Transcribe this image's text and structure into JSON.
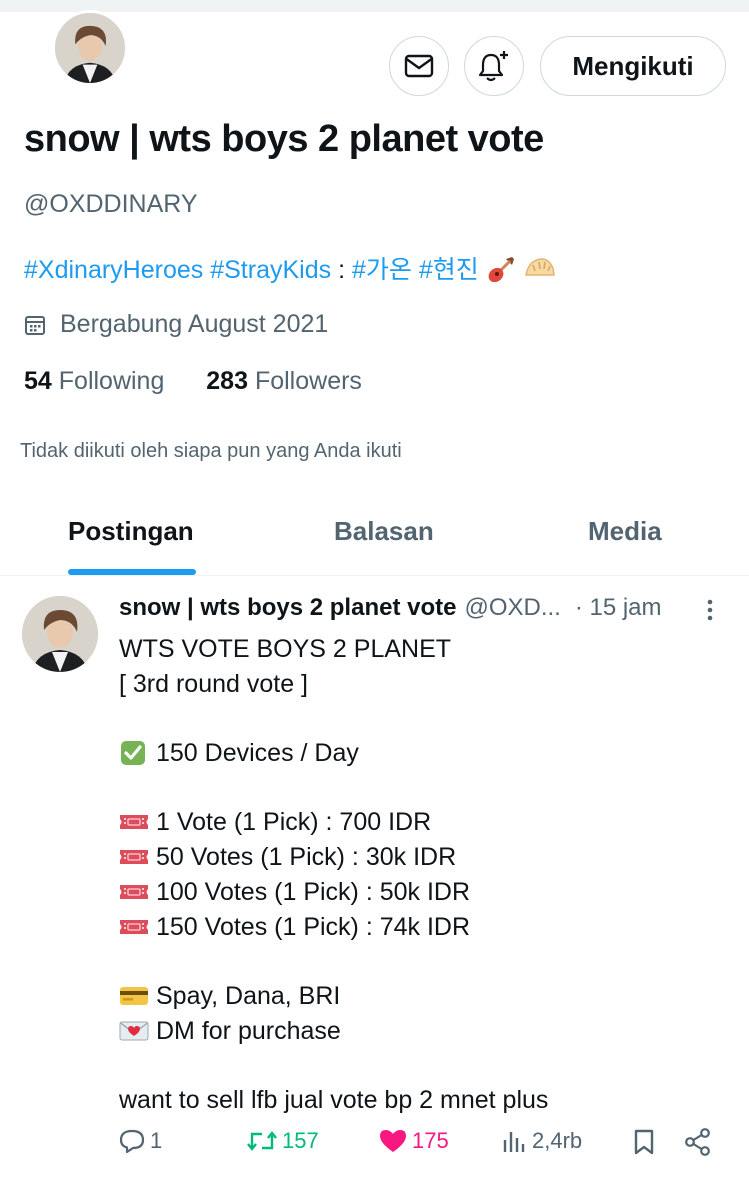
{
  "profile": {
    "display_name": "snow | wts boys 2 planet vote",
    "handle": "@OXDDINARY",
    "bio": {
      "tags": [
        "#XdinaryHeroes",
        "#StrayKids"
      ],
      "separator": ":",
      "tags2": [
        "#가온",
        "#현진"
      ],
      "emojis": [
        "guitar",
        "dumpling"
      ]
    },
    "joined": "Bergabung August 2021",
    "following_count": "54",
    "following_label": "Following",
    "followers_count": "283",
    "followers_label": "Followers",
    "not_followed_text": "Tidak diikuti oleh siapa pun yang Anda ikuti",
    "follow_button": "Mengikuti"
  },
  "tabs": [
    {
      "label": "Postingan",
      "active": true
    },
    {
      "label": "Balasan",
      "active": false
    },
    {
      "label": "Media",
      "active": false
    }
  ],
  "post": {
    "name": "snow | wts boys 2 planet vote",
    "handle": "@OXD...",
    "time": "· 15 jam",
    "lines": [
      {
        "emoji": "",
        "text": "WTS VOTE BOYS 2 PLANET"
      },
      {
        "emoji": "",
        "text": "[ 3rd round vote ]"
      },
      {
        "emoji": "",
        "text": ""
      },
      {
        "emoji": "check",
        "text": "150 Devices / Day"
      },
      {
        "emoji": "",
        "text": ""
      },
      {
        "emoji": "ticket",
        "text": "1 Vote (1 Pick) : 700 IDR"
      },
      {
        "emoji": "ticket",
        "text": "50 Votes (1 Pick) : 30k IDR"
      },
      {
        "emoji": "ticket",
        "text": "100 Votes (1 Pick) : 50k IDR"
      },
      {
        "emoji": "ticket",
        "text": "150 Votes (1 Pick) : 74k IDR"
      },
      {
        "emoji": "",
        "text": ""
      },
      {
        "emoji": "card",
        "text": "Spay, Dana, BRI"
      },
      {
        "emoji": "love-letter",
        "text": "DM for purchase"
      },
      {
        "emoji": "",
        "text": ""
      },
      {
        "emoji": "",
        "text": "want to sell lfb jual vote bp 2 mnet plus"
      }
    ],
    "stats": {
      "replies": "1",
      "retweets": "157",
      "likes": "175",
      "views": "2,4rb"
    }
  },
  "colors": {
    "accent": "#1d9bf0",
    "text": "#0f1419",
    "muted": "#536471",
    "retweet": "#00ba7c",
    "like": "#f91880"
  }
}
